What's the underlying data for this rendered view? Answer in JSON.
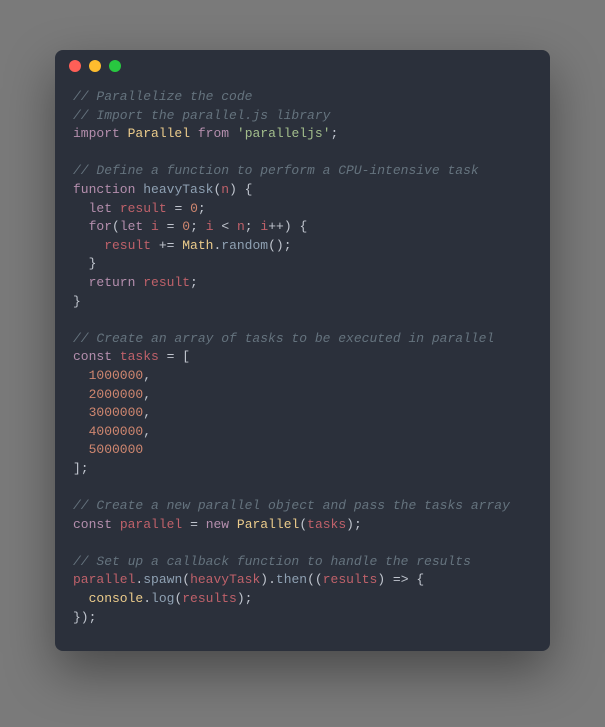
{
  "window": {
    "dots": [
      "red",
      "yellow",
      "green"
    ]
  },
  "code": {
    "line1": "// Parallelize the code",
    "line2": "// Import the parallel.js library",
    "line3_import": "import",
    "line3_parallel": "Parallel",
    "line3_from": "from",
    "line3_module": "'paralleljs'",
    "line3_semi": ";",
    "line5": "// Define a function to perform a CPU-intensive task",
    "line6_function": "function",
    "line6_name": "heavyTask",
    "line6_open": "(",
    "line6_param": "n",
    "line6_close": ") {",
    "line7_let": "  let",
    "line7_result": "result",
    "line7_eq": "=",
    "line7_zero": "0",
    "line7_semi": ";",
    "line8_for": "  for",
    "line8_open": "(",
    "line8_let": "let",
    "line8_i": "i",
    "line8_eq": "=",
    "line8_zero": "0",
    "line8_semi1": ";",
    "line8_i2": "i",
    "line8_lt": "<",
    "line8_n": "n",
    "line8_semi2": ";",
    "line8_i3": "i",
    "line8_inc": "++",
    "line8_close": ") {",
    "line9_result": "    result",
    "line9_pluseq": "+=",
    "line9_math": "Math",
    "line9_dot": ".",
    "line9_random": "random",
    "line9_parens": "();",
    "line10": "  }",
    "line11_return": "  return",
    "line11_result": "result",
    "line11_semi": ";",
    "line12": "}",
    "line14": "// Create an array of tasks to be executed in parallel",
    "line15_const": "const",
    "line15_tasks": "tasks",
    "line15_eq": "= [",
    "line16_val": "  1000000",
    "line16_comma": ",",
    "line17_val": "  2000000",
    "line17_comma": ",",
    "line18_val": "  3000000",
    "line18_comma": ",",
    "line19_val": "  4000000",
    "line19_comma": ",",
    "line20_val": "  5000000",
    "line21": "];",
    "line23": "// Create a new parallel object and pass the tasks array",
    "line24_const": "const",
    "line24_parallel": "parallel",
    "line24_eq": "=",
    "line24_new": "new",
    "line24_Parallel": "Parallel",
    "line24_open": "(",
    "line24_tasks": "tasks",
    "line24_close": ");",
    "line26": "// Set up a callback function to handle the results",
    "line27_parallel": "parallel",
    "line27_dot1": ".",
    "line27_spawn": "spawn",
    "line27_open1": "(",
    "line27_heavy": "heavyTask",
    "line27_close1": ").",
    "line27_then": "then",
    "line27_open2": "((",
    "line27_results": "results",
    "line27_arrow": ") => {",
    "line28_console": "  console",
    "line28_dot": ".",
    "line28_log": "log",
    "line28_open": "(",
    "line28_results": "results",
    "line28_close": ");",
    "line29": "});"
  }
}
